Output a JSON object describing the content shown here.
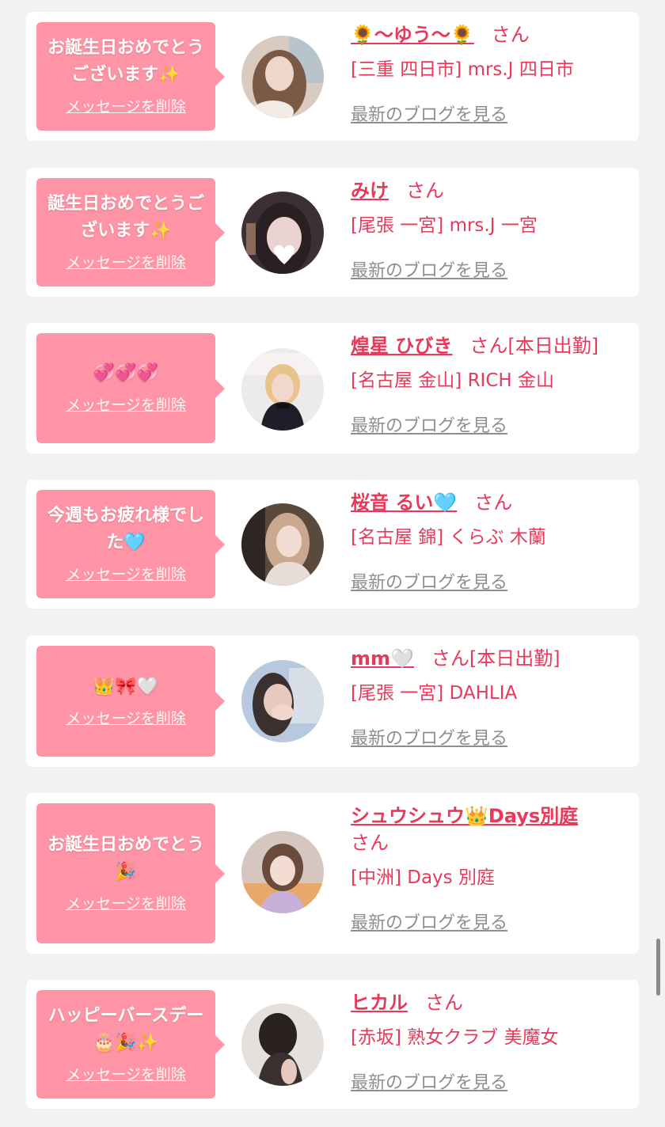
{
  "delete_label": "メッセージを削除",
  "honorific": "さん",
  "blog_label": "最新のブログを見る",
  "accent_color": "#e8395a",
  "bubble_color": "#ff94a6",
  "items": [
    {
      "message": "お誕生日おめでとうございます✨",
      "name": "🌻〜ゆう〜🌻",
      "tag": "",
      "shop": "[三重 四日市] mrs.J 四日市"
    },
    {
      "message": "誕生日おめでとうございます✨",
      "name": "みけ",
      "tag": "",
      "shop": "[尾張 一宮] mrs.J 一宮"
    },
    {
      "message": "💞💞💞",
      "name": "煌星 ひびき",
      "tag": "[本日出勤]",
      "shop": "[名古屋 金山] RICH 金山"
    },
    {
      "message": "今週もお疲れ様でした🩵",
      "name": "桜音 るい🩵",
      "tag": "",
      "shop": "[名古屋 錦] くらぶ 木蘭"
    },
    {
      "message": "👑🎀🤍",
      "name": "mm🤍",
      "tag": "[本日出勤]",
      "shop": "[尾張 一宮] DAHLIA"
    },
    {
      "message": "お誕生日おめでとう🎉",
      "name": "シュウシュウ👑Days別庭",
      "tag": "",
      "shop": "[中洲] Days 別庭"
    },
    {
      "message": "ハッピーバースデー🎂🎉✨",
      "name": "ヒカル",
      "tag": "",
      "shop": "[赤坂] 熟女クラブ 美魔女"
    }
  ]
}
